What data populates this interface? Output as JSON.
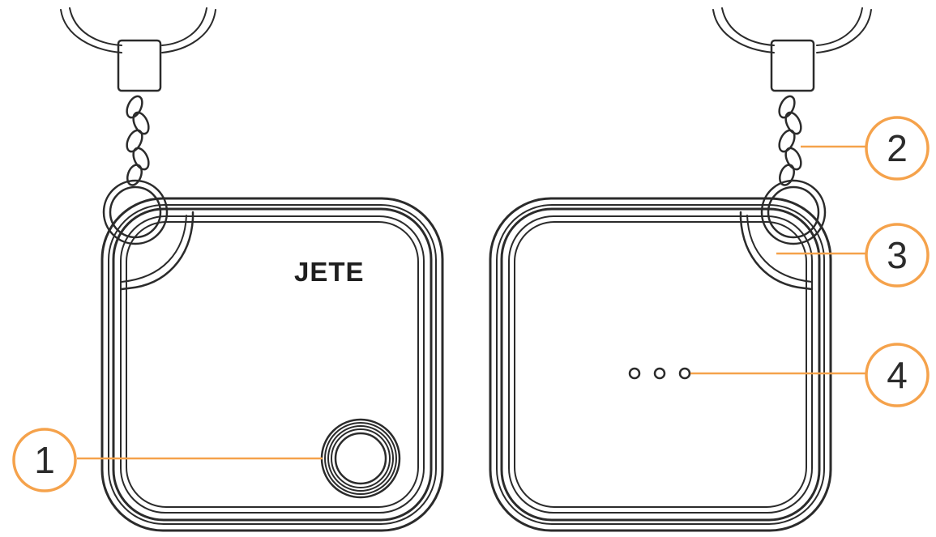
{
  "brand_text": "JETE",
  "accent_color": "#f5a24b",
  "stroke_color": "#2b2b2b",
  "callouts": [
    {
      "number": "1"
    },
    {
      "number": "2"
    },
    {
      "number": "3"
    },
    {
      "number": "4"
    }
  ],
  "views": [
    "front-view",
    "back-view"
  ]
}
